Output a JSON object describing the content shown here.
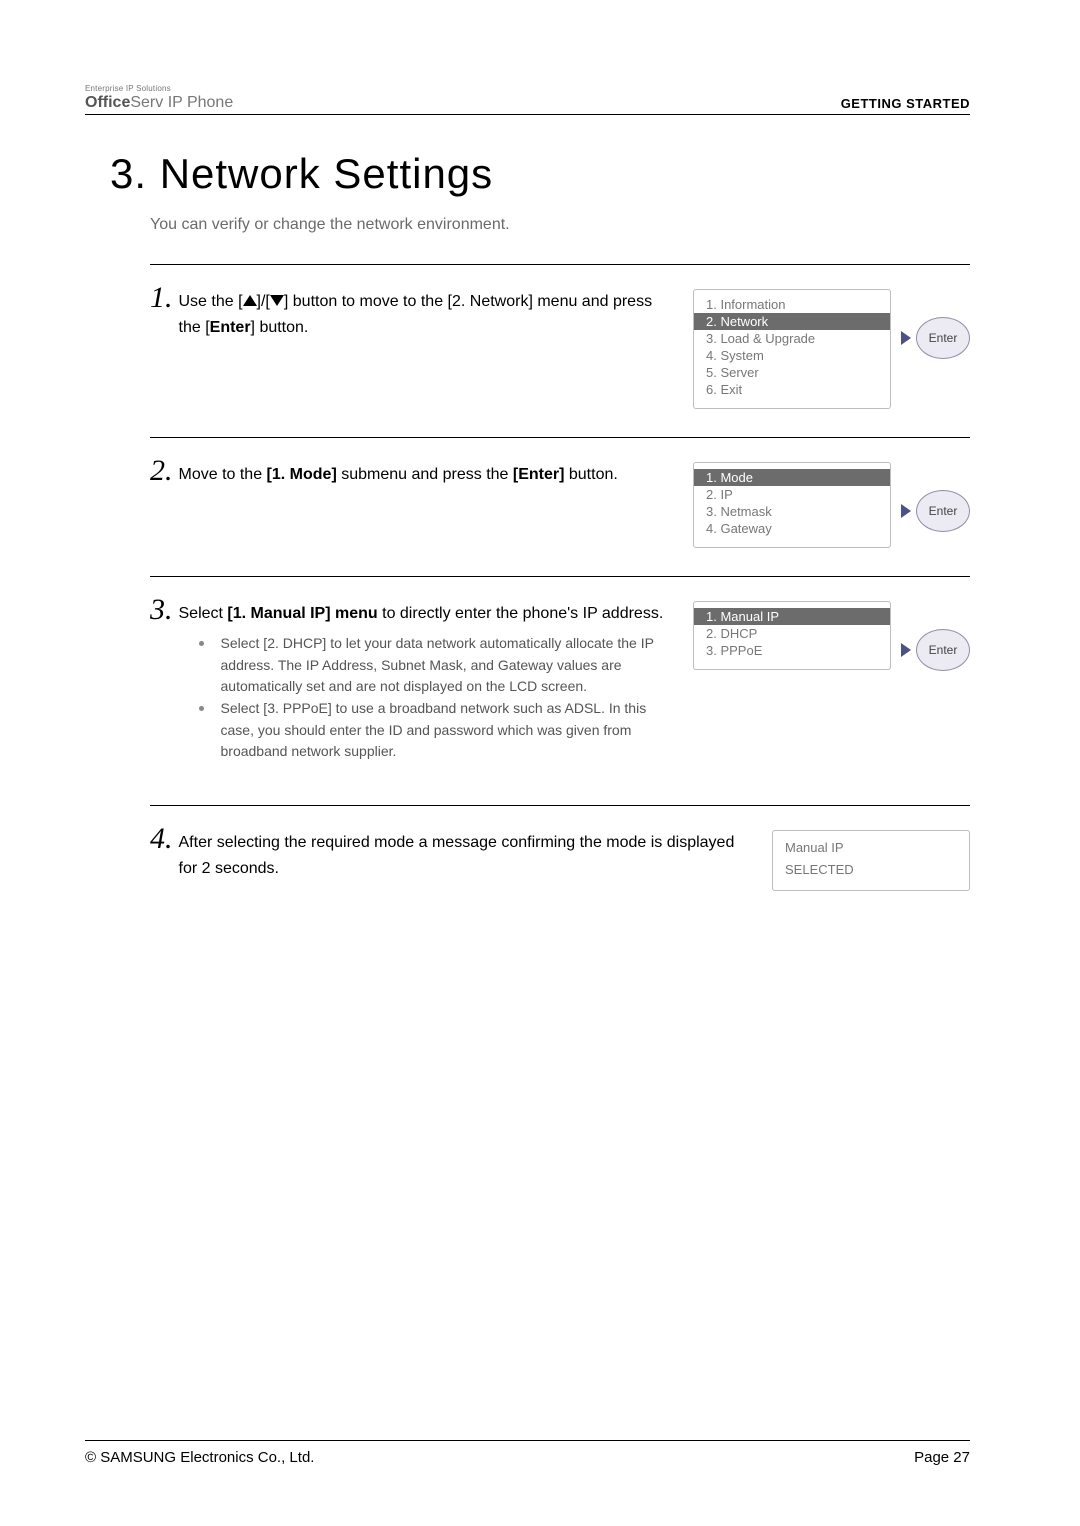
{
  "header": {
    "logo_small": "Enterprise IP Solutions",
    "logo_bold": "Office",
    "logo_rest": "Serv IP Phone",
    "section": "GETTING STARTED"
  },
  "title": "3. Network Settings",
  "intro": "You can verify or change the network environment.",
  "steps": {
    "s1": {
      "num": "1.",
      "text_pre": " Use the [",
      "text_mid": "]/[",
      "text_post": "] button to move to the [2. Network] menu and press the [",
      "text_bold1": "Enter",
      "text_end": "] button.",
      "lcd": [
        {
          "label": "1. Information",
          "sel": false
        },
        {
          "label": "2. Network",
          "sel": true
        },
        {
          "label": "3. Load & Upgrade",
          "sel": false
        },
        {
          "label": "4. System",
          "sel": false
        },
        {
          "label": "5. Server",
          "sel": false
        },
        {
          "label": "6. Exit",
          "sel": false
        }
      ],
      "enter": "Enter"
    },
    "s2": {
      "num": "2.",
      "text_pre": " Move to the ",
      "text_b": "[1. Mode]",
      "text_mid": " submenu and press the ",
      "text_b2": "[Enter]",
      "text_end": " button.",
      "lcd": [
        {
          "label": "1. Mode",
          "sel": true
        },
        {
          "label": "2. IP",
          "sel": false
        },
        {
          "label": "3. Netmask",
          "sel": false
        },
        {
          "label": "4. Gateway",
          "sel": false
        }
      ],
      "enter": "Enter"
    },
    "s3": {
      "num": "3.",
      "text_pre": " Select ",
      "text_b": "[1. Manual IP] menu",
      "text_mid": " to directly enter the phone's IP address.",
      "bullets": [
        "Select [2. DHCP] to let your data network automatically allocate the IP address. The IP Address, Subnet Mask, and Gateway values are automatically set and are not displayed on the LCD screen.",
        "Select [3. PPPoE] to use a broadband network such as ADSL. In this case, you should enter the ID and password which was given from broadband network supplier."
      ],
      "lcd": [
        {
          "label": "1. Manual IP",
          "sel": true
        },
        {
          "label": "2. DHCP",
          "sel": false
        },
        {
          "label": "3. PPPoE",
          "sel": false
        }
      ],
      "enter": "Enter"
    },
    "s4": {
      "num": "4.",
      "text": " After selecting the required mode a message confirming the mode is displayed for 2 seconds.",
      "lcd": [
        {
          "label": "Manual IP",
          "sel": false
        },
        {
          "label": "SELECTED",
          "sel": false
        }
      ]
    }
  },
  "footer": {
    "copyright": "© SAMSUNG Electronics Co., Ltd.",
    "page": "Page 27"
  }
}
